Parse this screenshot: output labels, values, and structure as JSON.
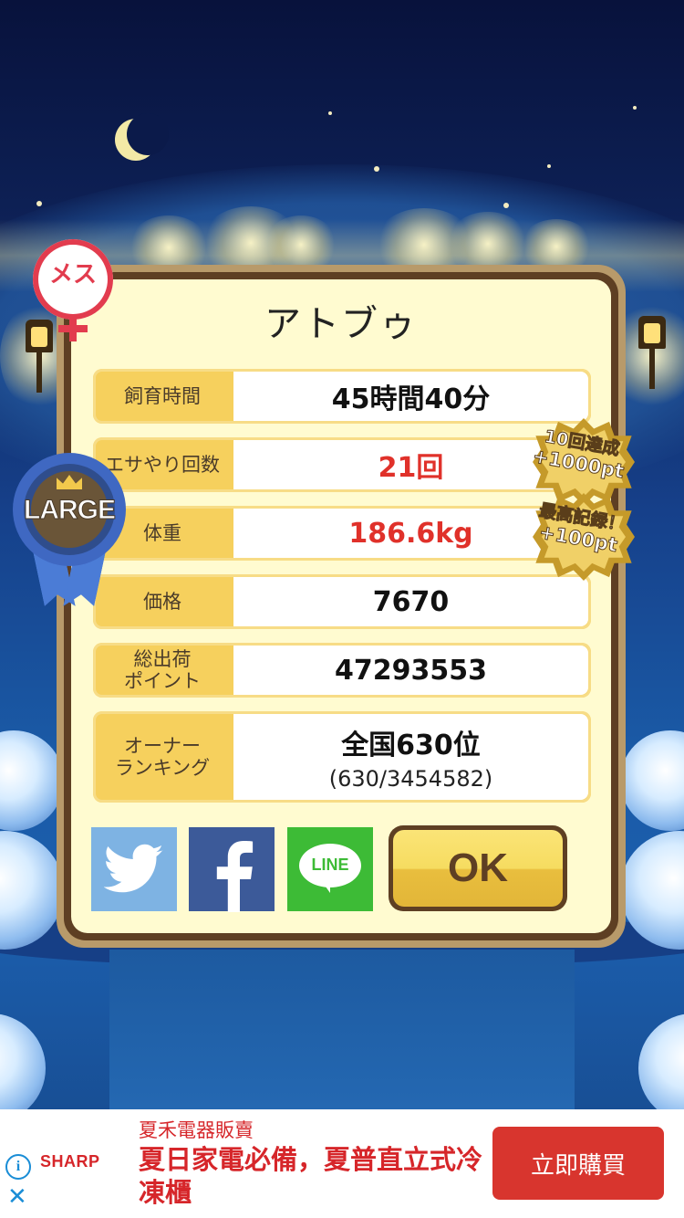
{
  "dialog": {
    "title": "アトブゥ",
    "gender_badge": "メス",
    "size_badge": "LARGE",
    "rows": [
      {
        "label": "飼育時間",
        "value": "45時間40分",
        "highlight": false
      },
      {
        "label": "エサやり回数",
        "value": "21回",
        "highlight": true
      },
      {
        "label": "体重",
        "value": "186.6kg",
        "highlight": true
      },
      {
        "label": "価格",
        "value": "7670",
        "highlight": false
      },
      {
        "label": "総出荷\nポイント",
        "value": "47293553",
        "highlight": false
      },
      {
        "label": "オーナー\nランキング",
        "value": "全国630位",
        "sub": "(630/3454582)",
        "highlight": false
      }
    ],
    "bonuses": [
      {
        "line1": "10回達成",
        "line2": "+1000pt"
      },
      {
        "line1": "最高記録！",
        "line2": "+100pt"
      }
    ],
    "share": {
      "twitter_icon": "twitter-bird-icon",
      "facebook_icon": "facebook-f-icon",
      "line_label": "LINE"
    },
    "ok_label": "OK"
  },
  "ad": {
    "brand": "SHARP",
    "top_text": "夏禾電器販賣",
    "main_text": "夏日家電必備，夏普直立式冷凍櫃",
    "button_label": "立即購買",
    "info_icon": "i",
    "close_icon": "✕"
  },
  "colors": {
    "accent_red": "#e0312a",
    "panel_cream": "#fffbd0",
    "label_yellow": "#f6d05d",
    "frame_brown": "#5e3f23",
    "twitter_blue": "#7eb3e3",
    "facebook_blue": "#3c5a99",
    "line_green": "#3dbb36"
  }
}
